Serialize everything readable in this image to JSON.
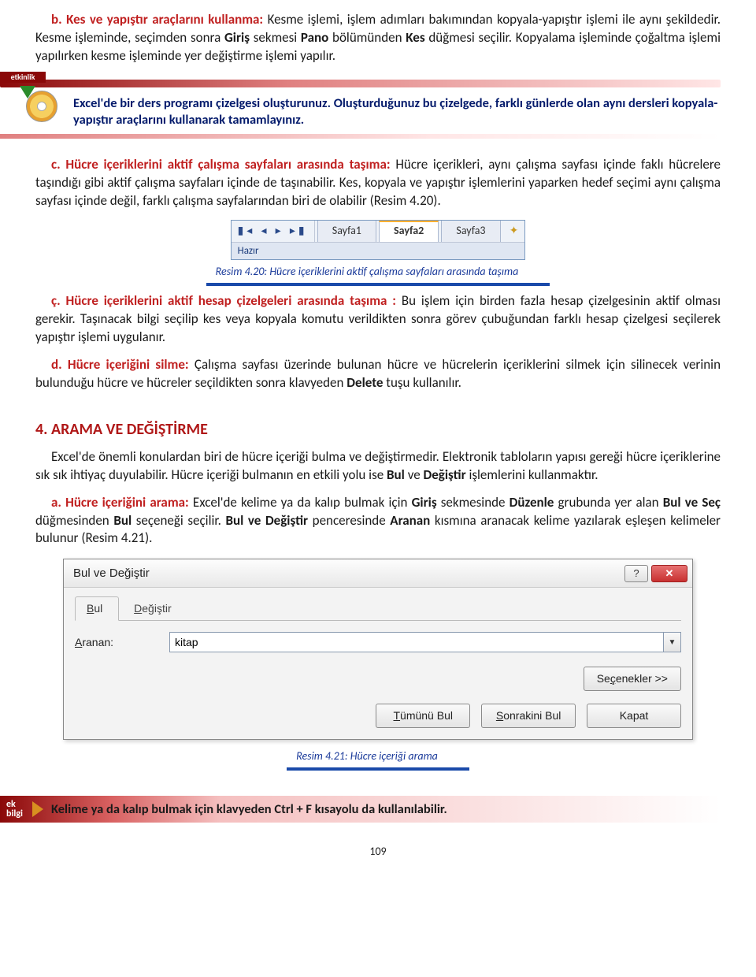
{
  "sec_b": {
    "lead": "b. Kes ve yapıştır araçlarını kullanma:",
    "body": " Kesme işlemi, işlem adımları bakımından kopyala-yapıştır işlemi ile aynı şekildedir. Kesme işleminde, seçimden sonra Giriş sekmesi Pano bölümünden Kes düğmesi seçilir. Kopyalama işleminde çoğaltma işlemi yapılırken kesme işleminde yer değiştirme işlemi yapılır.",
    "bold1": "Giriş",
    "bold2": "Pano",
    "bold3": "Kes"
  },
  "etkinlik": {
    "label": "etkinlik",
    "text": "Excel'de bir ders programı çizelgesi oluşturunuz. Oluşturduğunuz bu çizelgede, farklı günlerde olan aynı dersleri kopyala- yapıştır araçlarını kullanarak tamamlayınız."
  },
  "sec_c": {
    "lead": "c. Hücre içeriklerini aktif çalışma sayfaları arasında taşıma:",
    "body": " Hücre içerikleri, aynı çalışma sayfası içinde faklı hücrelere taşındığı gibi aktif çalışma sayfaları içinde de taşınabilir. Kes, kopyala ve yapıştır işlemlerini yaparken hedef seçimi aynı çalışma sayfası içinde değil, farklı çalışma sayfalarından biri de olabilir (Resim 4.20)."
  },
  "fig420": {
    "nav": "▮◂ ◂ ▸ ▸▮",
    "s1": "Sayfa1",
    "s2": "Sayfa2",
    "s3": "Sayfa3",
    "new": "✦",
    "status": "Hazır",
    "caption": "Resim 4.20: Hücre içeriklerini aktif çalışma sayfaları arasında taşıma"
  },
  "sec_cc": {
    "lead": "ç. Hücre içeriklerini aktif hesap çizelgeleri arasında taşıma :",
    "body": " Bu işlem için birden fazla hesap çizelgesinin aktif olması gerekir. Taşınacak bilgi seçilip kes veya kopyala komutu verildikten sonra görev çubuğundan farklı hesap çizelgesi seçilerek yapıştır işlemi uygulanır."
  },
  "sec_d": {
    "lead": "d. Hücre içeriğini silme:",
    "body": " Çalışma sayfası üzerinde bulunan hücre ve hücrelerin içeriklerini silmek için silinecek verinin bulunduğu hücre ve hücreler seçildikten sonra klavyeden Delete tuşu kullanılır.",
    "bold1": "Delete"
  },
  "h4": "4. ARAMA VE DEĞİŞTİRME",
  "p4_intro": "Excel'de önemli konulardan biri de hücre içeriği bulma ve değiştirmedir. Elektronik tabloların yapısı gereği hücre içeriklerine sık sık ihtiyaç duyulabilir. Hücre içeriği bulmanın en etkili yolu ise Bul ve Değiştir işlemlerini kullanmaktır.",
  "p4_bold1": "Bul",
  "p4_bold2": "Değiştir",
  "sec_a2": {
    "lead": "a. Hücre içeriğini arama:",
    "body": " Excel'de kelime ya da kalıp bulmak için Giriş sekmesinde Düzenle grubunda yer alan Bul ve Seç düğmesinden Bul seçeneği seçilir. Bul ve Değiştir penceresinde Aranan kısmına aranacak kelime yazılarak eşleşen kelimeler bulunur (Resim 4.21).",
    "b1": "Giriş",
    "b2": "Düzenle",
    "b3": "Bul ve Seç",
    "b4": "Bul",
    "b5": "Bul ve Değiştir",
    "b6": "Aranan"
  },
  "dialog": {
    "title": "Bul ve Değiştir",
    "help": "?",
    "close": "✕",
    "tab_find": "Bul",
    "tab_replace": "Değiştir",
    "label_search": "Aranan:",
    "input_value": "kitap",
    "options": "Seçenekler >>",
    "btn_findall": "Tümünü Bul",
    "btn_findnext": "Sonrakini Bul",
    "btn_close": "Kapat",
    "ul_T": "T",
    "ul_S": "S",
    "ul_B": "B",
    "ul_D": "D",
    "ul_A": "A",
    "ul_c": "ç"
  },
  "fig421_caption": "Resim 4.21: Hücre içeriği arama",
  "ekbilgi": {
    "tag1": "ek",
    "tag2": "bilgi",
    "text": "Kelime ya da kalıp bulmak için klavyeden Ctrl + F kısayolu da kullanılabilir."
  },
  "page": "109"
}
